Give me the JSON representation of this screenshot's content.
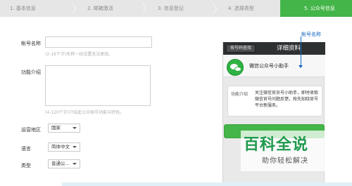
{
  "steps": [
    {
      "label": "1. 基本信息",
      "active": false
    },
    {
      "label": "2. 邮箱激活",
      "active": false
    },
    {
      "label": "3. 信息登记",
      "active": false
    },
    {
      "label": "4. 选择类型",
      "active": false
    },
    {
      "label": "5. 公众号信息",
      "active": true
    }
  ],
  "form": {
    "account_name_label": "帐号名称",
    "account_name_value": "",
    "account_name_hint": "(2-16个字)名称一经设置无法更改。",
    "intro_label": "功能介绍",
    "intro_value": "",
    "intro_hint": "(4-120个字)介绍此公众帐号功能与特色。",
    "region_label": "运营地区",
    "region_value": "国家",
    "language_label": "语言",
    "language_value": "简体中文",
    "type_label": "类型",
    "type_value": "普通公..."
  },
  "preview": {
    "back_button": "按号码查找",
    "title": "详细资料",
    "account_name": "微信公众号小助手",
    "func_label": "功能介绍",
    "func_desc": "关注微信官员号小助手，即时收取微信官号问题反馈，抢先知晓官号平台新服务。"
  },
  "annotation": {
    "label": "帐号名称"
  },
  "watermark": {
    "title": "百科全说",
    "subtitle": "助你轻松解决"
  },
  "colors": {
    "accent_green": "#44b549",
    "annotation_blue": "#1565c0"
  }
}
